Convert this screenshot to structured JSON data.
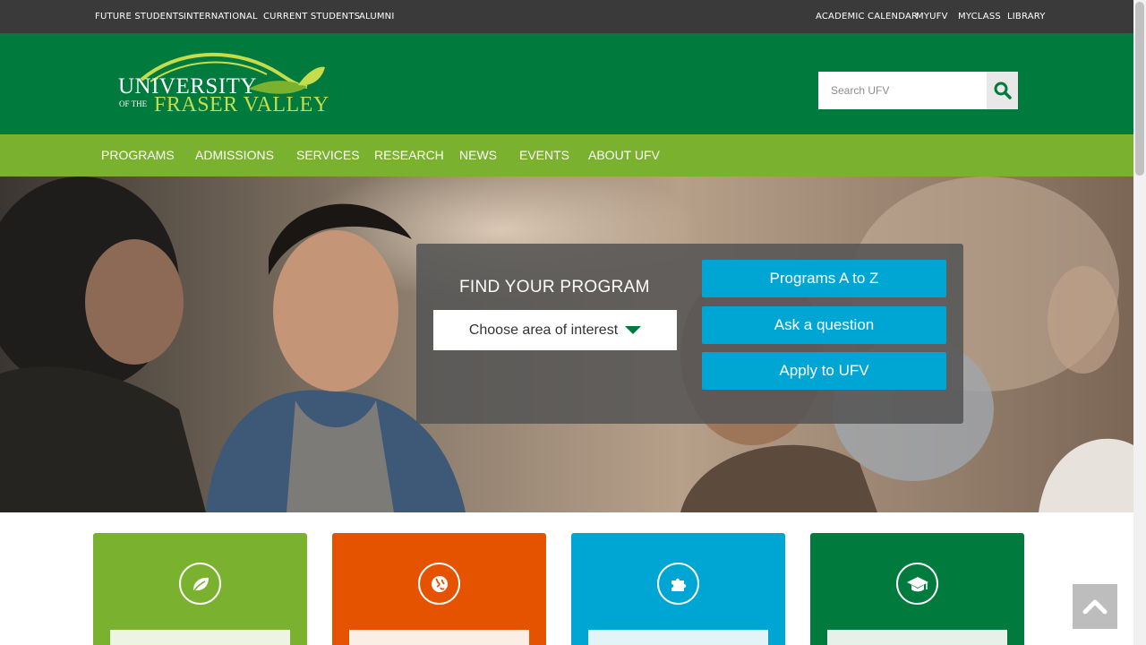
{
  "topbar": {
    "left_links": [
      "FUTURE STUDENTS",
      "INTERNATIONAL",
      "CURRENT STUDENTS",
      "ALUMNI"
    ],
    "right_links": [
      "ACADEMIC CALENDAR",
      "MYUFV",
      "MYCLASS",
      "LIBRARY"
    ]
  },
  "header": {
    "logo": {
      "line1": "UNIVERSITY",
      "line_of": "OF THE",
      "line2": "FRASER VALLEY"
    },
    "search": {
      "placeholder": "Search UFV",
      "icon": "search-icon"
    }
  },
  "mainnav": {
    "items": [
      "PROGRAMS",
      "ADMISSIONS",
      "SERVICES",
      "RESEARCH",
      "NEWS",
      "EVENTS",
      "ABOUT UFV"
    ]
  },
  "hero": {
    "finder_title": "FIND YOUR PROGRAM",
    "select_value": "Choose area of interest",
    "buttons": [
      "Programs A to Z",
      "Ask a question",
      "Apply to UFV"
    ]
  },
  "cards": [
    {
      "color": "#7ab22f",
      "panel_color": "#eef4e4",
      "icon": "leaf-icon"
    },
    {
      "color": "#e55300",
      "panel_color": "#fbeee5",
      "icon": "globe-icon"
    },
    {
      "color": "#00a6d3",
      "panel_color": "#e3f4f9",
      "icon": "puzzle-icon"
    },
    {
      "color": "#007b3d",
      "panel_color": "#e7f1ea",
      "icon": "graduation-cap-icon"
    }
  ],
  "colors": {
    "topbar": "#3a3a3a",
    "header": "#007b3d",
    "nav": "#7ab22f",
    "accent_blue": "#00a6d3"
  }
}
